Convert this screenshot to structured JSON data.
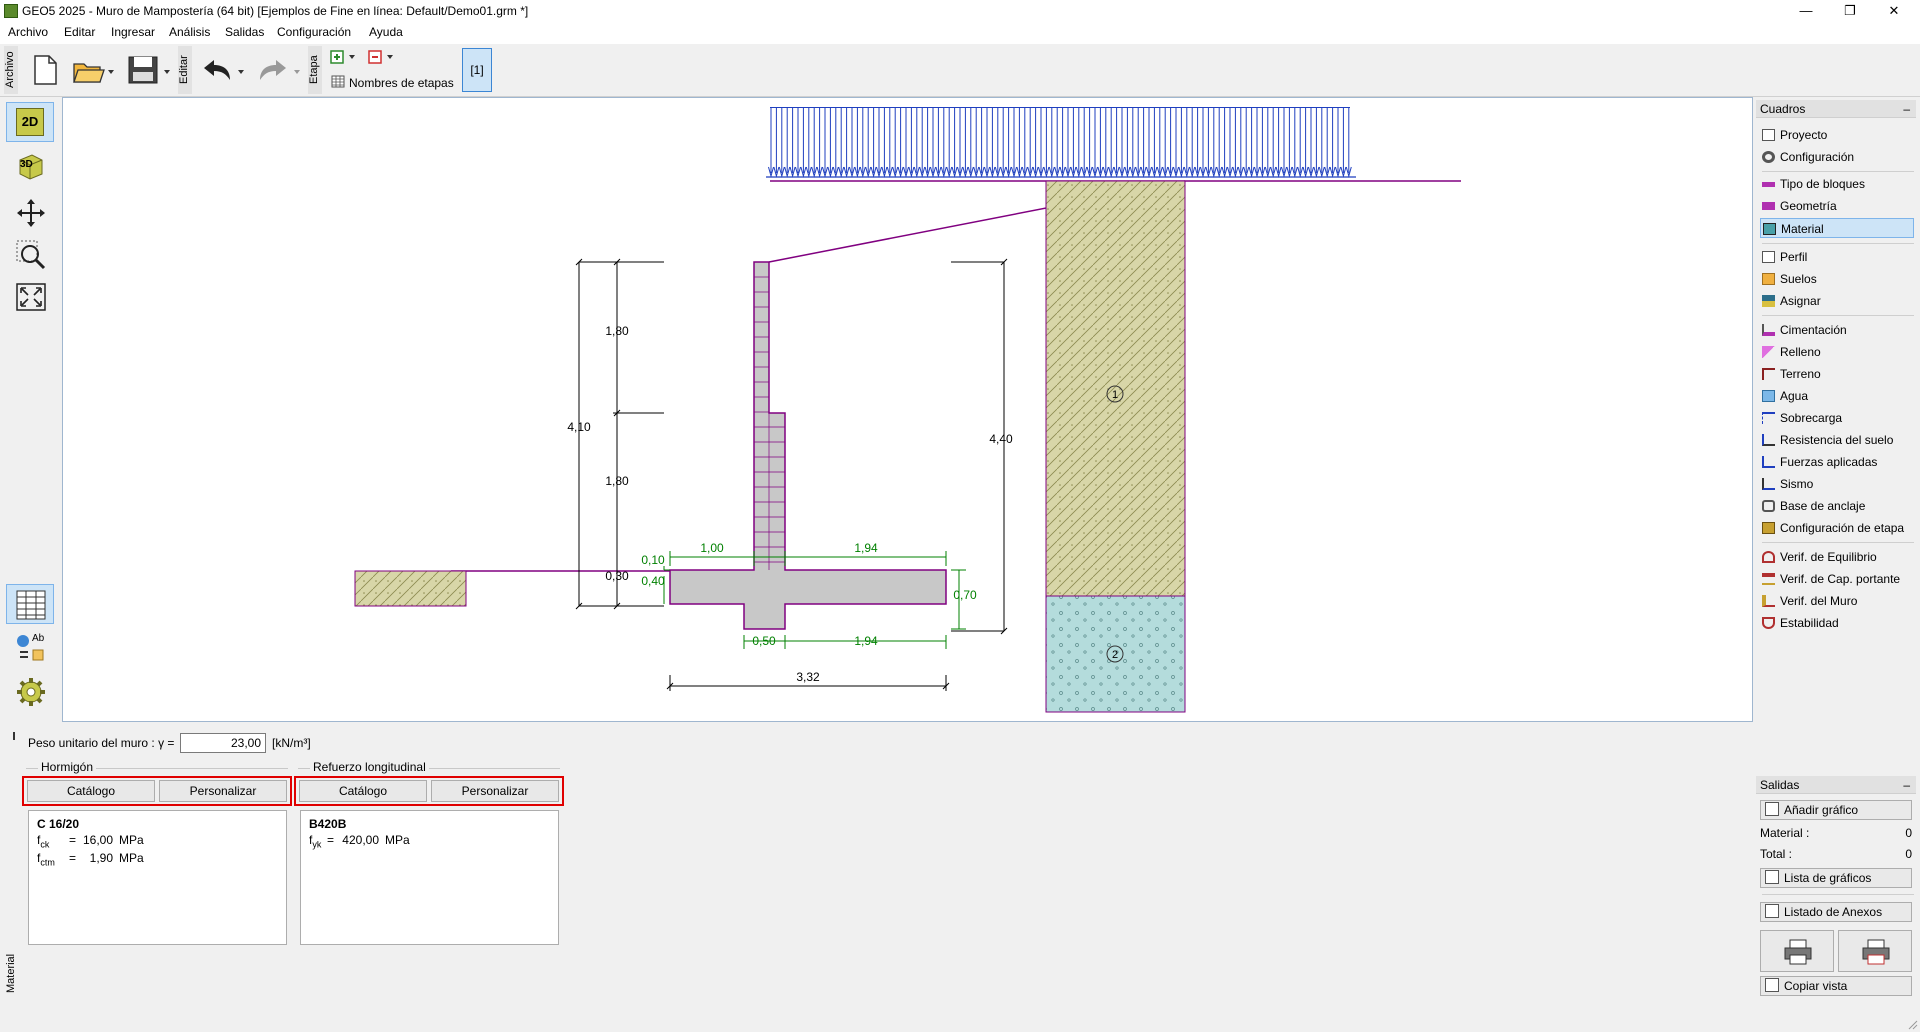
{
  "window": {
    "title": "GEO5 2025 - Muro de Mampostería (64 bit) [Ejemplos de Fine en línea: Default/Demo01.grm *]",
    "minimize": "—",
    "restore": "❐",
    "close": "✕"
  },
  "menu": [
    "Archivo",
    "Editar",
    "Ingresar",
    "Análisis",
    "Salidas",
    "Configuración",
    "Ayuda"
  ],
  "toolbar": {
    "archivo_label": "Archivo",
    "editar_label": "Editar",
    "etapa_label": "Etapa",
    "stage_names_label": "Nombres de etapas",
    "stage_button": "[1]"
  },
  "left_tools": {
    "btn_2d": "2D",
    "btn_3d": "3D",
    "btn_ab": "Ab"
  },
  "drawing": {
    "dims": {
      "d180a": "1,80",
      "d180b": "1,80",
      "d410": "4,10",
      "d440": "4,40",
      "d010": "0,10",
      "d030": "0,30",
      "d040": "0,40",
      "d100": "1,00",
      "d194a": "1,94",
      "d070": "0,70",
      "d050": "0,50",
      "d194b": "1,94",
      "d332": "3,32"
    },
    "soil_labels": [
      "1",
      "2"
    ],
    "colors": {
      "wall": "#c8c8c8",
      "wall_outline": "#800080",
      "soil1": "#d8d6a8",
      "soil2": "#b4dcdc",
      "surcharge": "#1f3fbf",
      "dimension_green": "#008000"
    }
  },
  "right_panel": {
    "cuadros_title": "Cuadros",
    "cuadros_collapse": "–",
    "items": [
      {
        "label": "Proyecto",
        "icon": "doc-icon"
      },
      {
        "label": "Configuración",
        "icon": "gear-icon"
      },
      {
        "label": "Tipo de bloques",
        "icon": "blocks-icon"
      },
      {
        "label": "Geometría",
        "icon": "geometry-icon"
      },
      {
        "label": "Material",
        "icon": "material-icon",
        "selected": true
      },
      {
        "label": "Perfil",
        "icon": "profile-icon"
      },
      {
        "label": "Suelos",
        "icon": "soils-icon"
      },
      {
        "label": "Asignar",
        "icon": "assign-icon"
      },
      {
        "label": "Cimentación",
        "icon": "foundation-icon"
      },
      {
        "label": "Relleno",
        "icon": "backfill-icon"
      },
      {
        "label": "Terreno",
        "icon": "terrain-icon"
      },
      {
        "label": "Agua",
        "icon": "water-icon"
      },
      {
        "label": "Sobrecarga",
        "icon": "surcharge-icon"
      },
      {
        "label": "Resistencia del suelo",
        "icon": "resistance-icon"
      },
      {
        "label": "Fuerzas aplicadas",
        "icon": "forces-icon"
      },
      {
        "label": "Sismo",
        "icon": "earthquake-icon"
      },
      {
        "label": "Base de anclaje",
        "icon": "anchor-icon"
      },
      {
        "label": "Configuración de etapa",
        "icon": "stage-settings-icon"
      },
      {
        "label": "Verif. de Equilibrio",
        "icon": "equilibrium-icon"
      },
      {
        "label": "Verif. de Cap. portante",
        "icon": "bearing-icon"
      },
      {
        "label": "Verif. del Muro",
        "icon": "wall-check-icon"
      },
      {
        "label": "Estabilidad",
        "icon": "stability-icon"
      }
    ],
    "salidas_title": "Salidas",
    "salidas_collapse": "–",
    "add_chart": "Añadir gráfico",
    "material_label": "Material :",
    "material_count": "0",
    "total_label": "Total :",
    "total_count": "0",
    "chart_list": "Lista de gráficos",
    "annex_list": "Listado de Anexos",
    "copy_view": "Copiar vista"
  },
  "bottom": {
    "side_label": "Material",
    "unit_weight_label": "Peso unitario del muro : γ =",
    "unit_weight_value": "23,00",
    "unit_weight_unit": "[kN/m³]",
    "concrete_group": "Hormigón",
    "reinforcement_group": "Refuerzo longitudinal",
    "catalog_button": "Catálogo",
    "customize_button": "Personalizar",
    "concrete": {
      "name": "C 16/20",
      "fck_sym": "f",
      "fck_sub": "ck",
      "fck_eq": "=",
      "fck_val": "16,00",
      "fck_unit": "MPa",
      "fctm_sym": "f",
      "fctm_sub": "ctm",
      "fctm_eq": "=",
      "fctm_val": "1,90",
      "fctm_unit": "MPa"
    },
    "steel": {
      "name": "B420B",
      "fyk_sym": "f",
      "fyk_sub": "yk",
      "fyk_eq": "=",
      "fyk_val": "420,00",
      "fyk_unit": "MPa"
    }
  }
}
